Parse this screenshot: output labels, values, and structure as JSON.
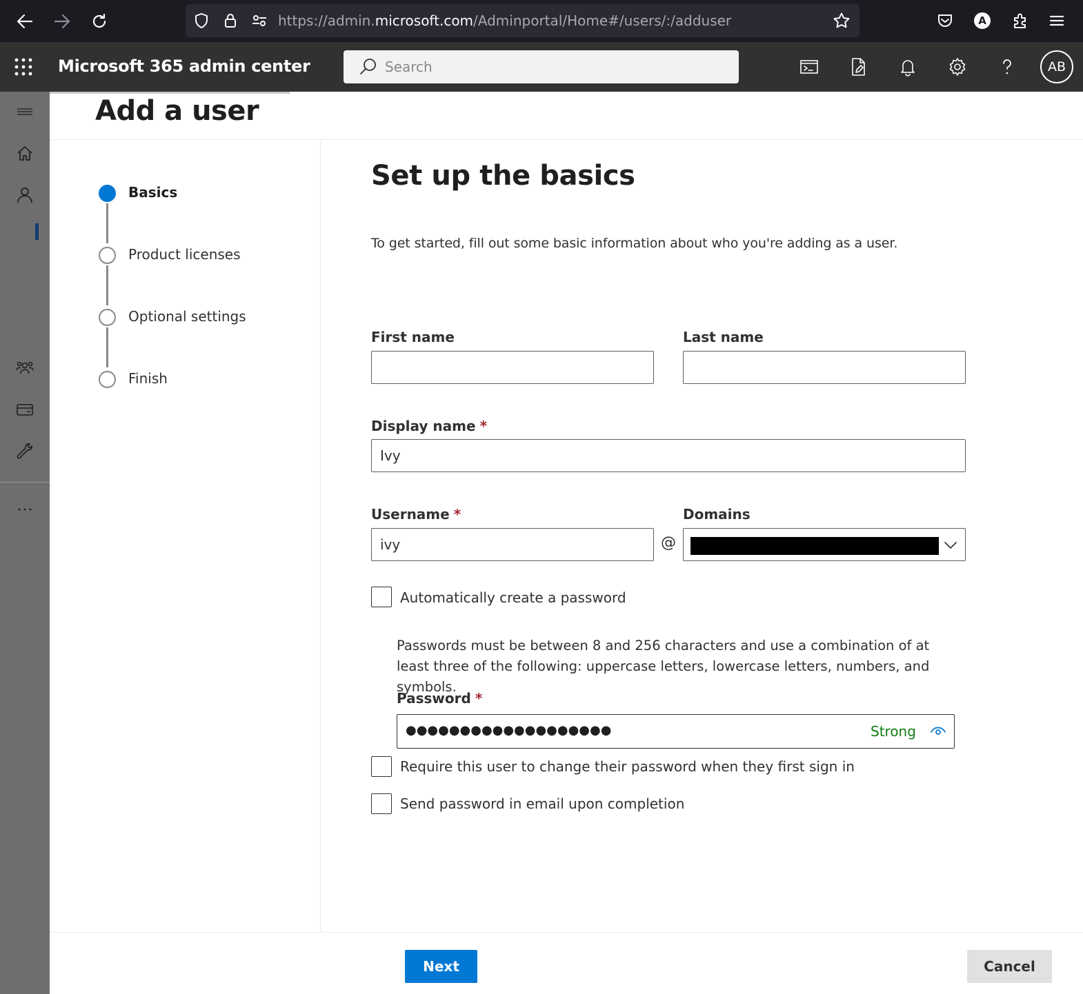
{
  "browser": {
    "url_prefix": "https://admin.",
    "url_host": "microsoft.com",
    "url_path": "/Adminportal/Home#/users/:/adduser",
    "profile_initial": "A"
  },
  "header": {
    "app_title": "Microsoft 365 admin center",
    "search_placeholder": "Search",
    "avatar_initials": "AB"
  },
  "page": {
    "title": "Add a user"
  },
  "steps": [
    {
      "label": "Basics",
      "state": "active"
    },
    {
      "label": "Product licenses",
      "state": "pending"
    },
    {
      "label": "Optional settings",
      "state": "pending"
    },
    {
      "label": "Finish",
      "state": "pending"
    }
  ],
  "form": {
    "section_title": "Set up the basics",
    "intro": "To get started, fill out some basic information about who you're adding as a user.",
    "first_name": {
      "label": "First name",
      "value": ""
    },
    "last_name": {
      "label": "Last name",
      "value": ""
    },
    "display_name": {
      "label": "Display name",
      "required_mark": "*",
      "value": "Ivy"
    },
    "username": {
      "label": "Username",
      "required_mark": "*",
      "value": "ivy"
    },
    "at_sign": "@",
    "domains": {
      "label": "Domains"
    },
    "auto_password": {
      "label": "Automatically create a password",
      "checked": false
    },
    "password_help": "Passwords must be between 8 and 256 characters and use a combination of at least three of the following: uppercase letters, lowercase letters, numbers, and symbols.",
    "password": {
      "label": "Password",
      "required_mark": "*",
      "masked_value": "●●●●●●●●●●●●●●●●●●●",
      "strength": "Strong"
    },
    "require_change": {
      "label": "Require this user to change their password when they first sign in",
      "checked": false
    },
    "send_email": {
      "label": "Send password in email upon completion",
      "checked": false
    }
  },
  "footer": {
    "next_label": "Next",
    "cancel_label": "Cancel"
  },
  "colors": {
    "accent": "#0078d4",
    "header_bg": "#323130",
    "rail_bg": "#6e6e6e",
    "strength_ok": "#107c10",
    "required": "#a4262c"
  }
}
